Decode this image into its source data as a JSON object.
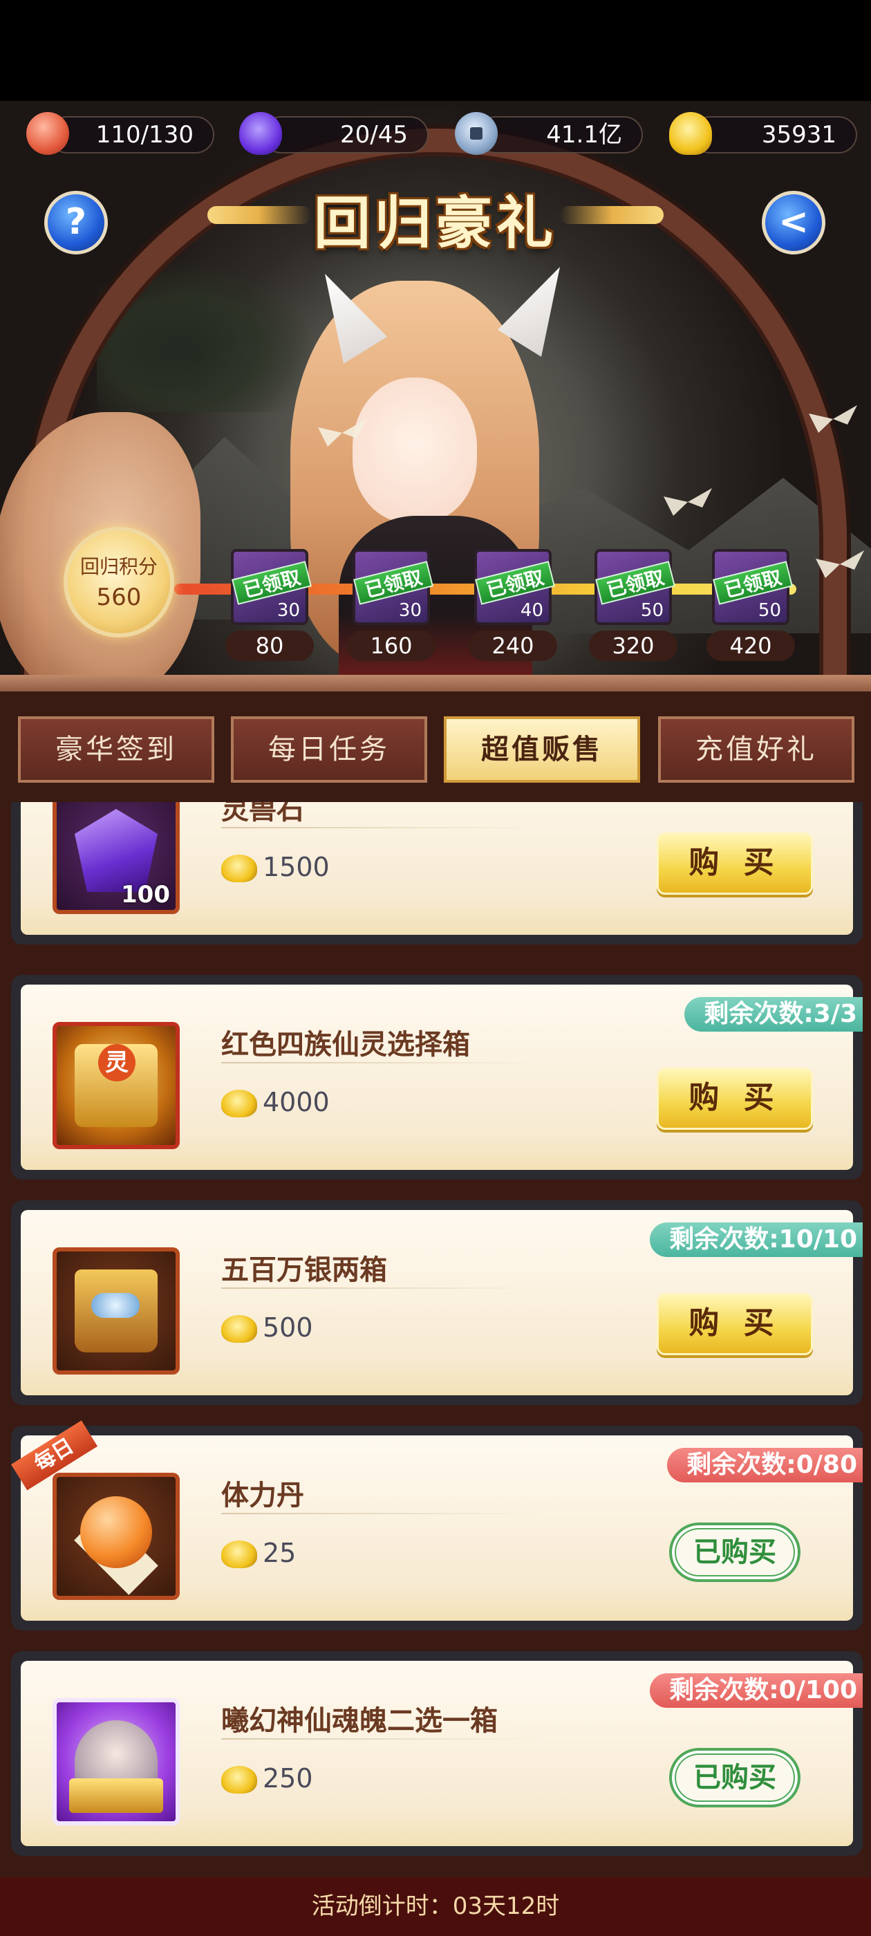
{
  "resources": [
    {
      "icon": "peach-icon",
      "value": "110/130"
    },
    {
      "icon": "spirit-flame-icon",
      "value": "20/45"
    },
    {
      "icon": "copper-coin-icon",
      "value": "41.1亿"
    },
    {
      "icon": "gold-ingot-icon",
      "value": "35931"
    }
  ],
  "header": {
    "title": "回归豪礼",
    "help_label": "?",
    "back_label": "<"
  },
  "score": {
    "label": "回归积分",
    "value": "560"
  },
  "milestones": [
    {
      "reward_qty": "30",
      "status": "已领取",
      "score": "80"
    },
    {
      "reward_qty": "30",
      "status": "已领取",
      "score": "160"
    },
    {
      "reward_qty": "40",
      "status": "已领取",
      "score": "240"
    },
    {
      "reward_qty": "50",
      "status": "已领取",
      "score": "320"
    },
    {
      "reward_qty": "50",
      "status": "已领取",
      "score": "420"
    }
  ],
  "tabs": [
    {
      "label": "豪华签到",
      "active": false
    },
    {
      "label": "每日任务",
      "active": false
    },
    {
      "label": "超值贩售",
      "active": true
    },
    {
      "label": "充值好礼",
      "active": false
    }
  ],
  "items": [
    {
      "name": "灵兽石",
      "price": "1500",
      "qty": "100",
      "remain": "",
      "button": "购 买",
      "bought": false,
      "daily": false,
      "icon": "spirit-stone-icon"
    },
    {
      "name": "红色四族仙灵选择箱",
      "price": "4000",
      "qty": "",
      "remain": "剩余次数:3/3",
      "button": "购 买",
      "bought": false,
      "daily": false,
      "icon": "spirit-chest-icon",
      "chest_badge": "灵"
    },
    {
      "name": "五百万银两箱",
      "price": "500",
      "qty": "",
      "remain": "剩余次数:10/10",
      "button": "购 买",
      "bought": false,
      "daily": false,
      "icon": "silver-chest-icon"
    },
    {
      "name": "体力丹",
      "price": "25",
      "qty": "",
      "remain": "剩余次数:0/80",
      "button": "已购买",
      "bought": true,
      "daily": true,
      "daily_label": "每日",
      "icon": "stamina-pill-icon"
    },
    {
      "name": "曦幻神仙魂魄二选一箱",
      "price": "250",
      "qty": "",
      "remain": "剩余次数:0/100",
      "button": "已购买",
      "bought": true,
      "daily": false,
      "icon": "soul-chest-icon"
    }
  ],
  "footer": {
    "countdown": "活动倒计时：03天12时"
  },
  "colors": {
    "tab_active": "#f1d27a",
    "buy_button": "#f5d64a",
    "bought_green": "#4fa85a",
    "remain_teal": "#4bb59f",
    "remain_red": "#e25b57"
  }
}
